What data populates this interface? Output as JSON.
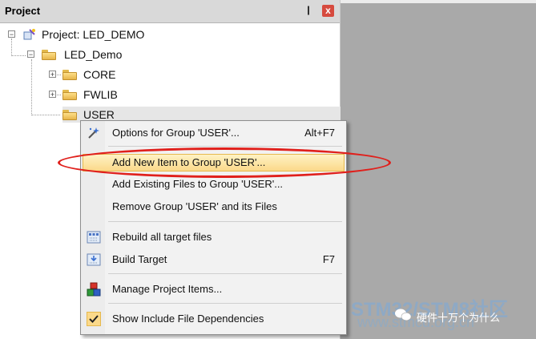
{
  "pane": {
    "title": "Project",
    "pin_glyph": "❙",
    "close_glyph": "x"
  },
  "tree": {
    "root": "Project: LED_DEMO",
    "target": "LED_Demo",
    "groups": [
      "CORE",
      "FWLIB",
      "USER"
    ]
  },
  "menu": {
    "items": [
      {
        "label": "Options for Group 'USER'...",
        "shortcut": "Alt+F7",
        "icon": "options-wand-icon"
      },
      {
        "label": "Add New  Item to Group 'USER'...",
        "shortcut": "",
        "icon": ""
      },
      {
        "label": "Add Existing Files to Group 'USER'...",
        "shortcut": "",
        "icon": ""
      },
      {
        "label": "Remove Group 'USER' and its Files",
        "shortcut": "",
        "icon": ""
      },
      {
        "label": "Rebuild all target files",
        "shortcut": "",
        "icon": "rebuild-icon"
      },
      {
        "label": "Build Target",
        "shortcut": "F7",
        "icon": "build-icon"
      },
      {
        "label": "Manage Project Items...",
        "shortcut": "",
        "icon": "manage-items-icon"
      },
      {
        "label": "Show Include File Dependencies",
        "shortcut": "",
        "icon": "checkmark-icon"
      }
    ]
  },
  "watermark": {
    "text": "STM32/STM8社区",
    "account": "硬件十万个为什么",
    "url": "www.stmcu.org.cn"
  },
  "colors": {
    "highlight": "#fbd98a",
    "annotation": "#e0201c",
    "titlebar": "#d9d9d9"
  }
}
